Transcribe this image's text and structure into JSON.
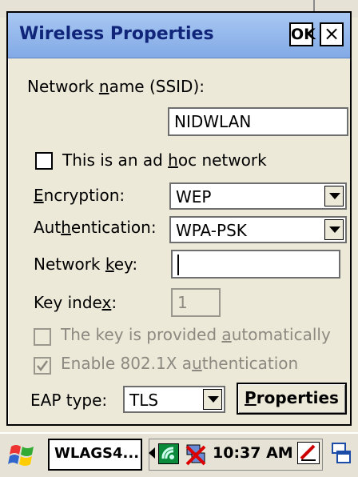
{
  "dialog": {
    "title": "Wireless Properties",
    "ok_label": "OK",
    "close_label": "×"
  },
  "form": {
    "ssid_label_pre": "Network ",
    "ssid_label_u": "n",
    "ssid_label_post": "ame (SSID):",
    "ssid_value": "NIDWLAN",
    "adhoc_label_pre": "This is an ad ",
    "adhoc_label_u": "h",
    "adhoc_label_post": "oc network",
    "adhoc_checked": false,
    "encryption_label_u": "E",
    "encryption_label_post": "ncryption:",
    "encryption_value": "WEP",
    "auth_label_pre": "Aut",
    "auth_label_u": "h",
    "auth_label_post": "entication:",
    "auth_value": "WPA-PSK",
    "netkey_label_pre": "Network ",
    "netkey_label_u": "k",
    "netkey_label_post": "ey:",
    "netkey_value": "",
    "keyindex_label_pre": "Key inde",
    "keyindex_label_u": "x",
    "keyindex_label_post": ":",
    "keyindex_value": "1",
    "auto_label_pre": "The key is provided ",
    "auto_label_u": "a",
    "auto_label_post": "utomatically",
    "auto_checked": false,
    "enable8021x_label_pre": "Enable 802.1X a",
    "enable8021x_label_u": "u",
    "enable8021x_label_post": "thentication",
    "enable8021x_checked": true,
    "eap_label": "EAP type:",
    "eap_value": "TLS",
    "properties_label_u": "P",
    "properties_label_post": "roperties"
  },
  "taskbar": {
    "task_label": "WLAGS4...",
    "clock": "10:37 AM"
  },
  "icons": {
    "start": "windows-flag-icon",
    "network": "network-signal-icon",
    "disconnected": "network-disconnected-icon",
    "edit": "pen-edit-icon",
    "desktop": "show-desktop-icon"
  }
}
